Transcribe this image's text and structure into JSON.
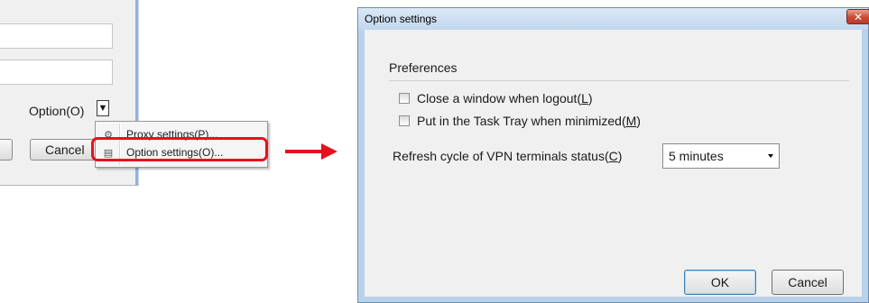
{
  "parent_dialog": {
    "option_label": "Option(O)",
    "option_arrow": "▼",
    "cancel_label": "Cancel"
  },
  "menu": {
    "items": [
      {
        "label": "Proxy settings(P)...",
        "icon": "proxy-icon"
      },
      {
        "label": "Option settings(O)...",
        "icon": "option-icon"
      }
    ]
  },
  "dialog": {
    "title": "Option settings",
    "close_glyph": "✕",
    "group_title": "Preferences",
    "check_close": {
      "text": "Close a window when logout(",
      "key": "L",
      "end": ")",
      "checked": false
    },
    "check_tray": {
      "text": "Put in the Task Tray when minimized(",
      "key": "M",
      "end": ")",
      "checked": false
    },
    "refresh": {
      "text": "Refresh cycle of VPN terminals status(",
      "key": "C",
      "end": ")",
      "selected": "5 minutes"
    },
    "ok_label": "OK",
    "cancel_label": "Cancel"
  },
  "colors": {
    "highlight": "#e8101c",
    "arrow": "#e8101c"
  }
}
